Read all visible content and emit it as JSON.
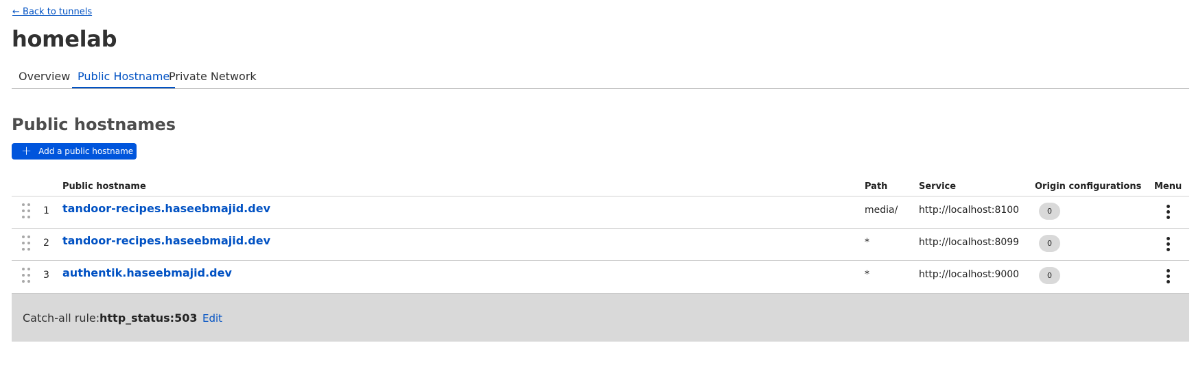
{
  "nav": {
    "back_link": "← Back to tunnels"
  },
  "page": {
    "title": "homelab"
  },
  "tabs": [
    {
      "label": "Overview",
      "active": false
    },
    {
      "label": "Public Hostname",
      "active": true
    },
    {
      "label": "Private Network",
      "active": false
    }
  ],
  "section": {
    "title": "Public hostnames",
    "add_button_label": "Add a public hostname",
    "add_button_icon": "plus-icon"
  },
  "table": {
    "columns": {
      "hostname": "Public hostname",
      "path": "Path",
      "service": "Service",
      "origin": "Origin configurations",
      "menu": "Menu"
    },
    "rows": [
      {
        "index": "1",
        "hostname": "tandoor-recipes.haseebmajid.dev",
        "path": "media/",
        "service": "http://localhost:8100",
        "origin_count": "0"
      },
      {
        "index": "2",
        "hostname": "tandoor-recipes.haseebmajid.dev",
        "path": "*",
        "service": "http://localhost:8099",
        "origin_count": "0"
      },
      {
        "index": "3",
        "hostname": "authentik.haseebmajid.dev",
        "path": "*",
        "service": "http://localhost:9000",
        "origin_count": "0"
      }
    ]
  },
  "catch_all": {
    "label": "Catch-all rule:",
    "rule": "http_status:503",
    "edit_label": "Edit"
  },
  "colors": {
    "accent": "#0051c3",
    "button": "#0055dc",
    "catch_all_bg": "#d9d9d9",
    "badge_bg": "#d9d9d9"
  }
}
